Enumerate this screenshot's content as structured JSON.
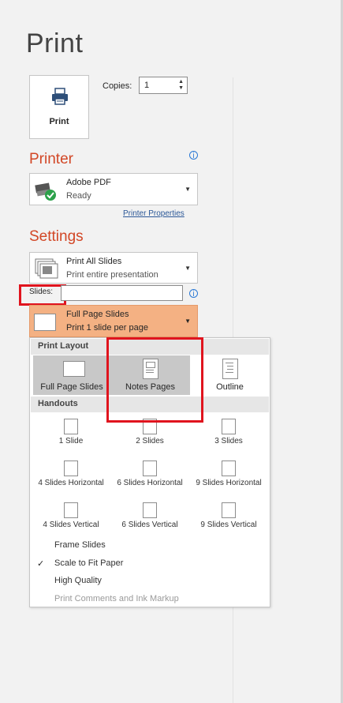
{
  "page": {
    "title": "Print"
  },
  "print_button": {
    "label": "Print"
  },
  "copies": {
    "label": "Copies:",
    "value": "1"
  },
  "printer": {
    "heading": "Printer",
    "name": "Adobe PDF",
    "status": "Ready",
    "properties_link": "Printer Properties"
  },
  "settings": {
    "heading": "Settings",
    "range": {
      "title": "Print All Slides",
      "subtitle": "Print entire presentation"
    },
    "slides_label": "Slides:",
    "slides_value": "",
    "layout": {
      "title": "Full Page Slides",
      "subtitle": "Print 1 slide per page"
    }
  },
  "menu": {
    "print_layout_header": "Print Layout",
    "print_layout": [
      {
        "label": "Full Page Slides",
        "selected": true
      },
      {
        "label": "Notes Pages",
        "selected": false
      },
      {
        "label": "Outline",
        "selected": false
      }
    ],
    "handouts_header": "Handouts",
    "handouts": [
      [
        "1 Slide",
        "2 Slides",
        "3 Slides"
      ],
      [
        "4 Slides Horizontal",
        "6 Slides Horizontal",
        "9 Slides Horizontal"
      ],
      [
        "4 Slides Vertical",
        "6 Slides Vertical",
        "9 Slides Vertical"
      ]
    ],
    "options": [
      {
        "label": "Frame Slides",
        "checked": false,
        "enabled": true
      },
      {
        "label": "Scale to Fit Paper",
        "checked": true,
        "enabled": true
      },
      {
        "label": "High Quality",
        "checked": false,
        "enabled": true
      },
      {
        "label": "Print Comments and Ink Markup",
        "checked": false,
        "enabled": false
      }
    ],
    "checkmark": "✓"
  },
  "colors": {
    "accent": "#d24726",
    "highlight": "#f4b183",
    "annotation": "#e0141e"
  }
}
